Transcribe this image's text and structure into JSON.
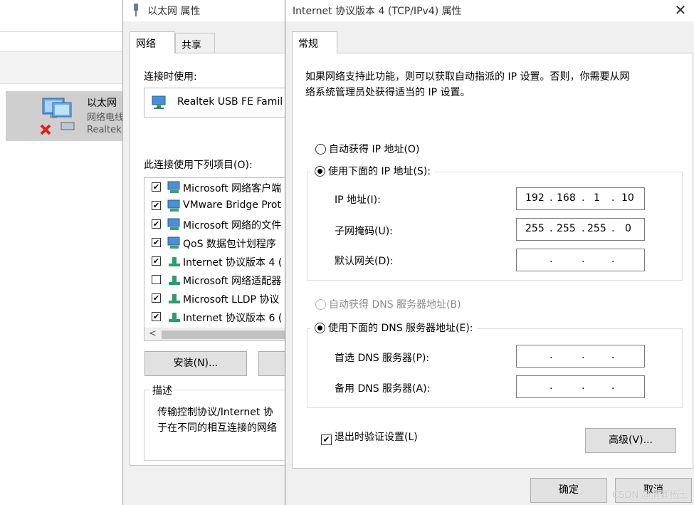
{
  "explorer": {
    "adapter_name": "以太网",
    "adapter_status": "网络电线",
    "adapter_device": "Realtek"
  },
  "eth_dialog": {
    "title": "以太网 属性",
    "tabs": [
      {
        "label": "网络"
      },
      {
        "label": "共享"
      }
    ],
    "connect_using_label": "连接时使用:",
    "adapter_text": "Realtek USB FE Famil",
    "items_label": "此连接使用下列项目(O):",
    "items": [
      {
        "label": "Microsoft 网络客户端",
        "checked": "✔"
      },
      {
        "label": "VMware Bridge Prot",
        "checked": "✔"
      },
      {
        "label": "Microsoft 网络的文件",
        "checked": "✔"
      },
      {
        "label": "QoS 数据包计划程序",
        "checked": "✔"
      },
      {
        "label": "Internet 协议版本 4 (",
        "checked": "✔"
      },
      {
        "label": "Microsoft 网络适配器",
        "checked": ""
      },
      {
        "label": "Microsoft LLDP 协议",
        "checked": "✔"
      },
      {
        "label": "Internet 协议版本 6 (",
        "checked": "✔"
      }
    ],
    "scroll_left": "<",
    "install_label": "安装(N)...",
    "description_legend": "描述",
    "description_line1": "传输控制协议/Internet 协",
    "description_line2": "于在不同的相互连接的网络"
  },
  "ipv4_dialog": {
    "title": "Internet 协议版本 4 (TCP/IPv4) 属性",
    "close": "✕",
    "tab_general": "常规",
    "info_line1": "如果网络支持此功能，则可以获取自动指派的 IP 设置。否则，你需要从网",
    "info_line2": "络系统管理员处获得适当的 IP 设置。",
    "auto_ip_label": "自动获得 IP 地址(O)",
    "manual_ip_label": "使用下面的 IP 地址(S):",
    "ip_label": "IP 地址(I):",
    "ip_value": [
      "192",
      "168",
      "1",
      "10"
    ],
    "subnet_label": "子网掩码(U):",
    "subnet_value": [
      "255",
      "255",
      "255",
      "0"
    ],
    "gateway_label": "默认网关(D):",
    "auto_dns_label": "自动获得 DNS 服务器地址(B)",
    "manual_dns_label": "使用下面的 DNS 服务器地址(E):",
    "preferred_dns_label": "首选 DNS 服务器(P):",
    "alternate_dns_label": "备用 DNS 服务器(A):",
    "dot": ".",
    "validate_label": "退出时验证设置(L)",
    "validate_check": "✔",
    "advanced_label": "高级(V)...",
    "ok_label": "确定",
    "cancel_label": "取消"
  },
  "watermark": "CSDN @渭卿杨土"
}
